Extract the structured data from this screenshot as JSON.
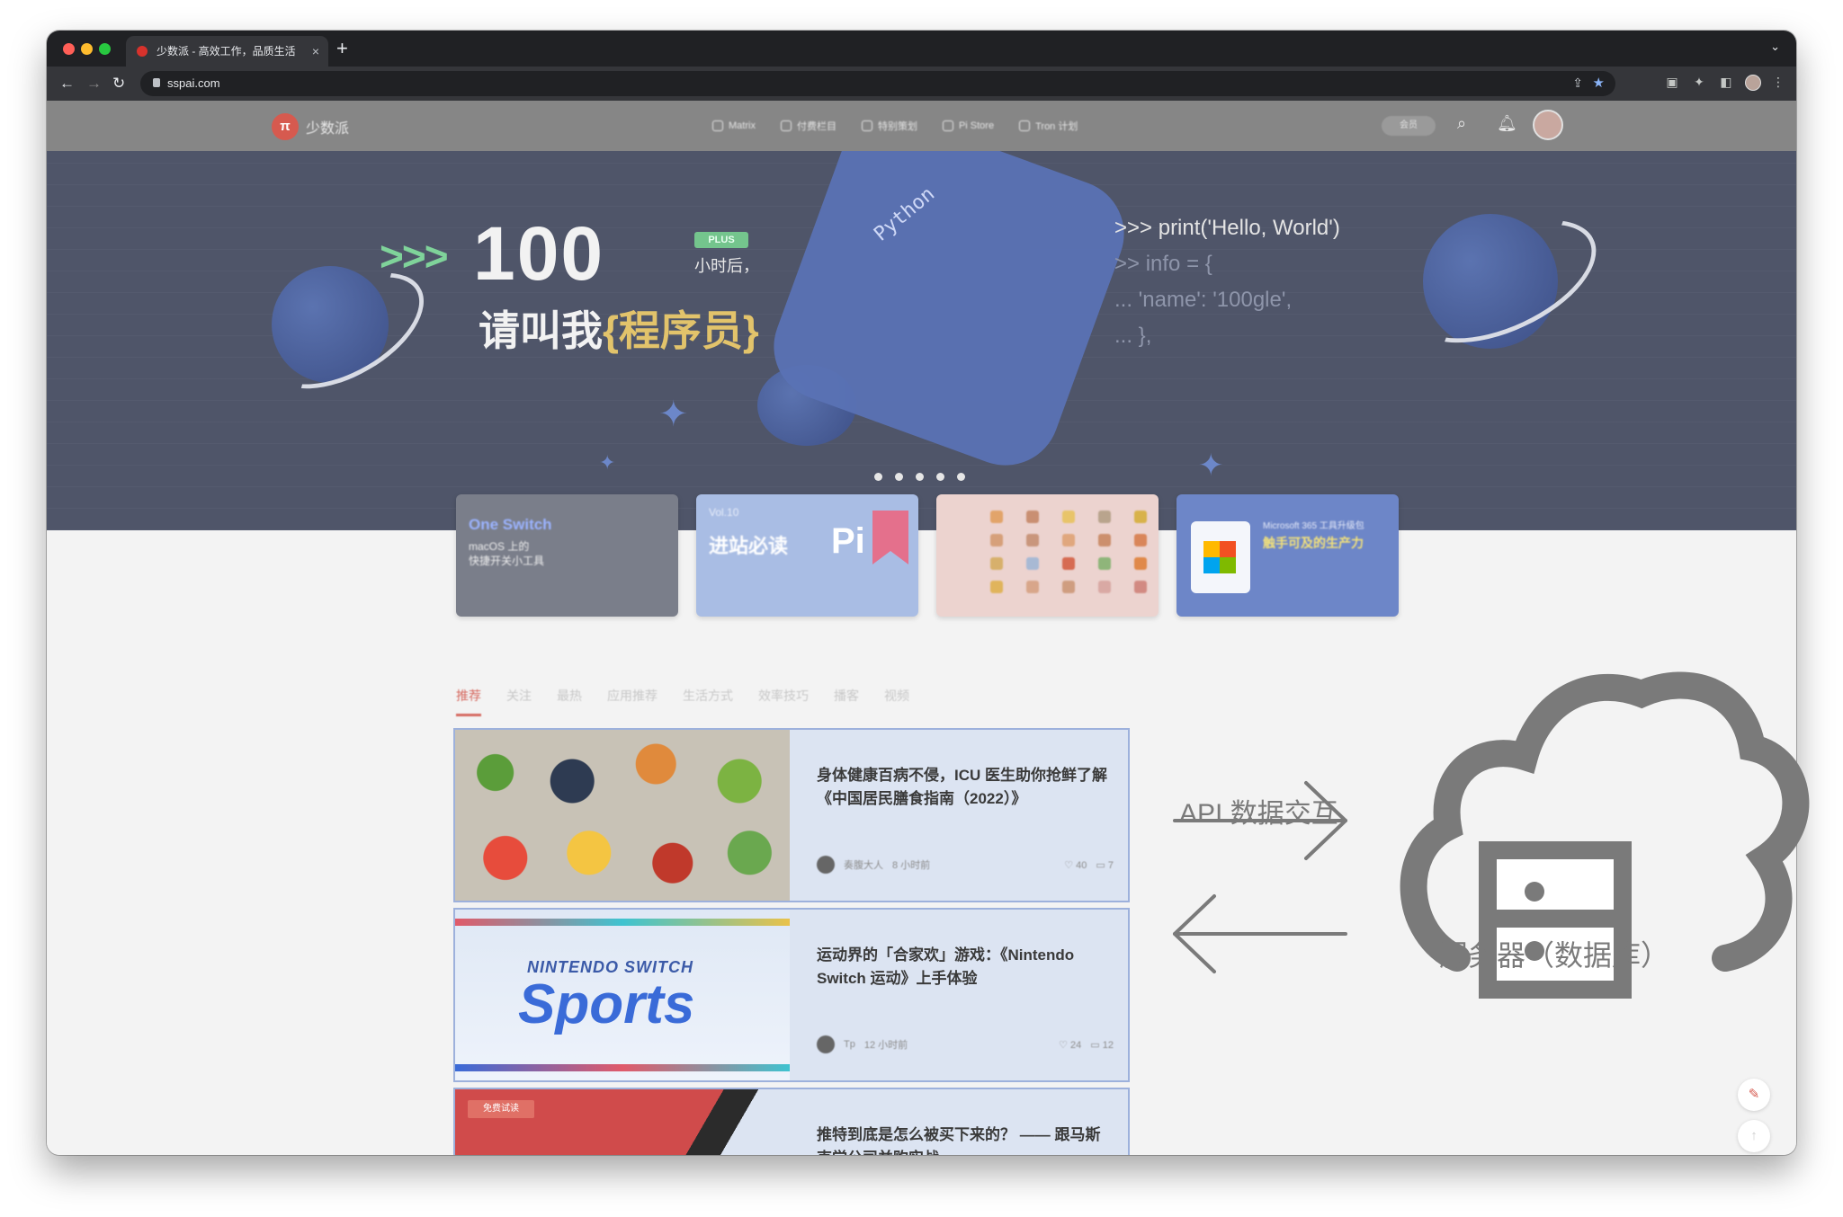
{
  "browser": {
    "tab_title": "少数派 - 高效工作，品质生活",
    "tab_close": "×",
    "new_tab": "+",
    "tab_list": "⌄",
    "url": "sspai.com",
    "back": "←",
    "forward": "→",
    "reload": "↻"
  },
  "site": {
    "logo_mark": "π",
    "logo_text": "少数派",
    "nav": [
      "Matrix",
      "付费栏目",
      "特别策划",
      "Pi Store",
      "Tron 计划"
    ],
    "member_label": "会员"
  },
  "hero": {
    "prompt": ">>>",
    "number": "100",
    "badge": "PLUS",
    "hours_text": "小时后，",
    "line2_prefix": "请叫我",
    "line2_highlight": "{程序员}",
    "code": [
      ">>> print('Hello, World')",
      ">> info = {",
      "...    'name': '100gle',",
      "...  },"
    ],
    "cube_text": "Python",
    "slides": 5
  },
  "feature_cards": [
    {
      "title": "One Switch",
      "subtitle": "macOS 上的\n快捷开关小工具"
    },
    {
      "title": "进站必读",
      "subtitle": "Vol.10"
    },
    {
      "title": "",
      "subtitle": ""
    },
    {
      "title": "触手可及的生产力",
      "subtitle": "Microsoft 365 工具升级包"
    }
  ],
  "category_tabs": [
    "推荐",
    "关注",
    "最热",
    "应用推荐",
    "生活方式",
    "效率技巧",
    "播客",
    "视频"
  ],
  "articles": [
    {
      "title": "身体健康百病不侵，ICU 医生助你抢鲜了解《中国居民膳食指南（2022）》",
      "author": "奏腹大人",
      "time": "8 小时前",
      "likes": "40",
      "comments": "7"
    },
    {
      "title": "运动界的「合家欢」游戏：《Nintendo Switch 运动》上手体验",
      "author": "Tp",
      "time": "12 小时前",
      "likes": "24",
      "comments": "12",
      "thumb_brand": "NINTENDO SWITCH",
      "thumb_title": "Sports"
    },
    {
      "title": "推特到底是怎么被买下来的？ —— 跟马斯克学公司并购实战",
      "badge": "免费试读"
    }
  ],
  "diagram": {
    "api_label": "API 数据交互",
    "server_label": "服务器（数据库）",
    "arrow_color": "#7a7a7a"
  },
  "icons": {
    "search": "search-icon",
    "bell": "bell-icon",
    "edit": "pencil-icon",
    "top": "arrow-up-icon"
  }
}
